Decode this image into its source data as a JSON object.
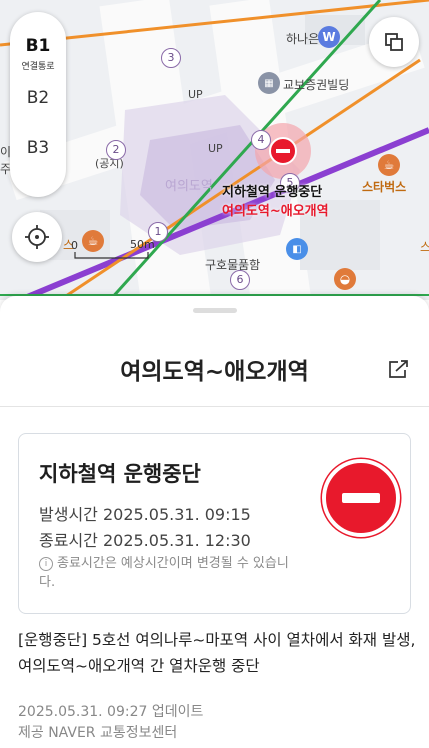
{
  "map": {
    "floors": [
      {
        "label": "B1",
        "sub": "연결통로",
        "active": true
      },
      {
        "label": "B2",
        "sub": ""
      },
      {
        "label": "B3",
        "sub": ""
      }
    ],
    "labels": {
      "hana_bank": "하나은행",
      "kyobo_building": "교보증권빌딩",
      "starbucks": "스타벅스",
      "guho_square": "구호물품함",
      "up_1": "UP",
      "up_2": "UP",
      "gong": "(공지)",
      "scale": "50m",
      "scale_zero": "0",
      "alert_line1": "지하철역 운행중단",
      "alert_line2": "여의도역~애오개역",
      "station_ghost": "여의도역",
      "bank_badge": "W",
      "left_edge": "주",
      "left_edge_2": "이",
      "left_edge_3": "스",
      "right_edge": "스"
    },
    "exit_numbers": [
      "1",
      "2",
      "3",
      "4",
      "5",
      "6"
    ]
  },
  "sheet": {
    "title": "여의도역~애오개역",
    "card": {
      "title": "지하철역 운행중단",
      "occurred": "발생시간 2025.05.31. 09:15",
      "ended": "종료시간 2025.05.31. 12:30",
      "note": "종료시간은 예상시간이며 변경될 수 있습니다."
    },
    "description": "[운행중단] 5호선 여의나루~마포역 사이 열차에서 화재 발생, 여의도역~애오개역 간 열차운행 중단",
    "updated": "2025.05.31. 09:27 업데이트",
    "source": "제공 NAVER 교통정보센터"
  },
  "colors": {
    "alert_red": "#e8192c",
    "line5_purple": "#8b3fd1",
    "line_green": "#2fa84f",
    "line_orange": "#f0902a"
  },
  "icons": [
    "locate-icon",
    "layers-icon",
    "share-icon",
    "stop-sign-icon",
    "info-icon",
    "coffee-icon",
    "bank-icon"
  ]
}
